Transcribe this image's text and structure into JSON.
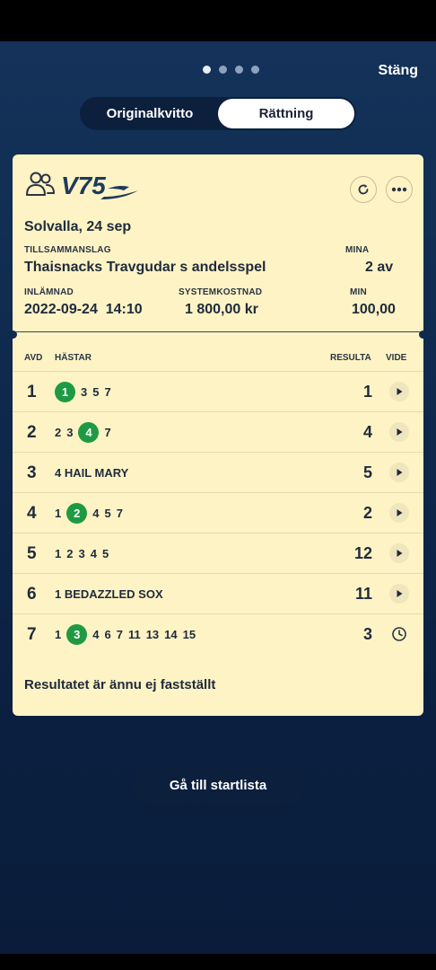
{
  "pager": {
    "pages": 4,
    "active_index": 0
  },
  "header": {
    "close_label": "Stäng"
  },
  "tabs": [
    {
      "label": "Originalkvitto",
      "active": false
    },
    {
      "label": "Rättning",
      "active": true
    }
  ],
  "receipt": {
    "game_logo": "V75",
    "track_date": "Solvalla, 24 sep",
    "team_label": "TILLSAMMANSLAG",
    "team_value": "Thaisnacks Travgudar s andelsspel",
    "mine_label": "MINA",
    "mine_value": "2 av",
    "submitted_label": "INLÄMNAD",
    "submitted_value": "2022-09-24  14:10",
    "cost_label": "SYSTEMKOSTNAD",
    "cost_value": "1 800,00 kr",
    "min_label": "MIN",
    "min_value": "100,00"
  },
  "table": {
    "headers": {
      "avd": "AVD",
      "horses": "HÄSTAR",
      "result": "RESULTA",
      "video": "VIDE"
    },
    "rows": [
      {
        "avd": "1",
        "horses": [
          "1",
          "3",
          "5",
          "7"
        ],
        "winner": "1",
        "result": "1",
        "video": "play"
      },
      {
        "avd": "2",
        "horses": [
          "2",
          "3",
          "4",
          "7"
        ],
        "winner": "4",
        "result": "4",
        "video": "play"
      },
      {
        "avd": "3",
        "horses": [
          "4 HAIL MARY"
        ],
        "winner": "",
        "result": "5",
        "video": "play"
      },
      {
        "avd": "4",
        "horses": [
          "1",
          "2",
          "4",
          "5",
          "7"
        ],
        "winner": "2",
        "result": "2",
        "video": "play"
      },
      {
        "avd": "5",
        "horses": [
          "1",
          "2",
          "3",
          "4",
          "5"
        ],
        "winner": "",
        "result": "12",
        "video": "play"
      },
      {
        "avd": "6",
        "horses": [
          "1 BEDAZZLED SOX"
        ],
        "winner": "",
        "result": "11",
        "video": "play"
      },
      {
        "avd": "7",
        "horses": [
          "1",
          "3",
          "4",
          "6",
          "7",
          "11",
          "13",
          "14",
          "15"
        ],
        "winner": "3",
        "result": "3",
        "video": "clock"
      }
    ]
  },
  "status_note": "Resultatet är ännu ej fastställt",
  "cta_label": "Gå till startlista",
  "colors": {
    "card_bg": "#fdf3c4",
    "win_green": "#1e9a43",
    "bg_dark": "#0f2a4e"
  }
}
